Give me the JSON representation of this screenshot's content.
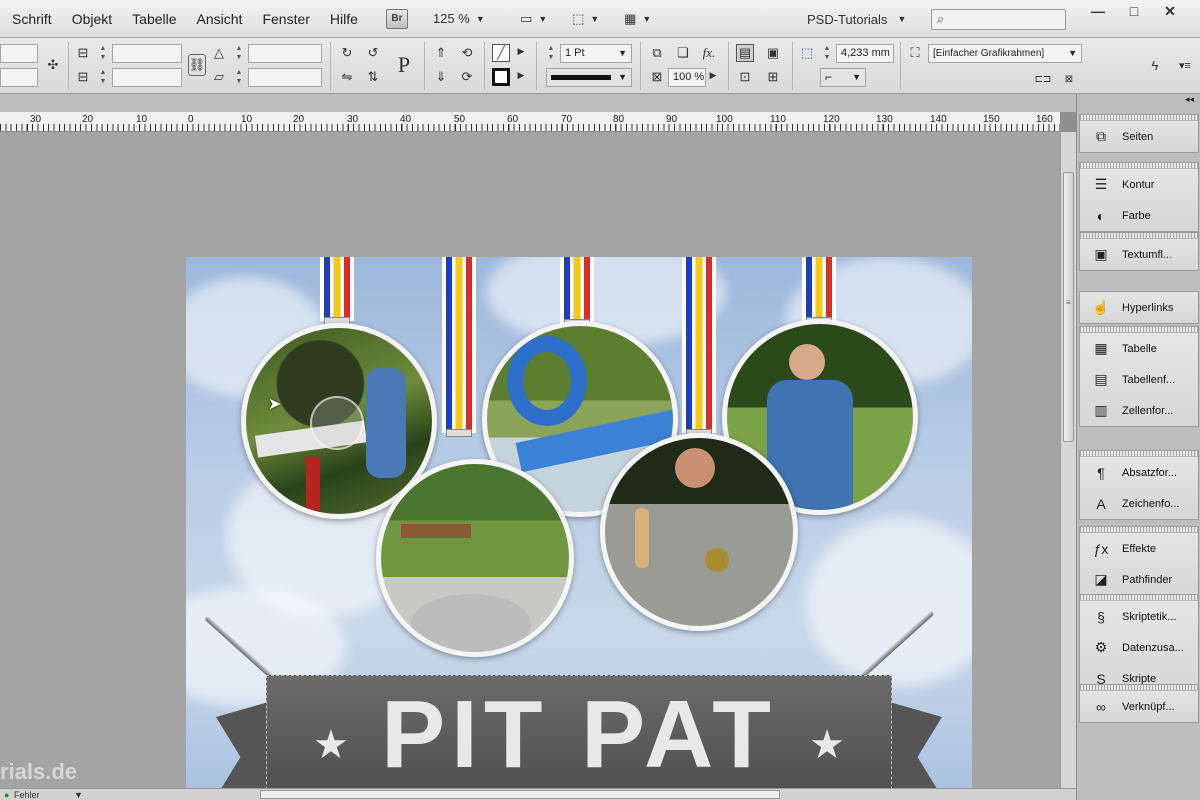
{
  "menu": {
    "items": [
      "Schrift",
      "Objekt",
      "Tabelle",
      "Ansicht",
      "Fenster",
      "Hilfe"
    ],
    "bridge_badge": "Br",
    "zoom": "125 %",
    "workspace": "PSD-Tutorials",
    "window_minimize": "—",
    "window_maximize": "□",
    "window_close": "✕"
  },
  "control": {
    "stroke_weight": "1 Pt",
    "object_style": "[Einfacher Grafikrahmen]",
    "stroke_width_value": "4,233 mm",
    "opacity": "100 %",
    "fx_label": "fx."
  },
  "ruler": {
    "labels": [
      "30",
      "20",
      "10",
      "0",
      "10",
      "20",
      "30",
      "40",
      "50",
      "60",
      "70",
      "80",
      "90",
      "100",
      "110",
      "120",
      "130",
      "140",
      "150",
      "160"
    ]
  },
  "document": {
    "banner_text": "PIT PAT",
    "star": "★",
    "watermark": "rials.de"
  },
  "status": {
    "errors": "Fehler"
  },
  "panels": {
    "groups": [
      [
        {
          "label": "Seiten",
          "icon": "pages-icon",
          "glyph": "⧉"
        }
      ],
      [
        {
          "label": "Kontur",
          "icon": "stroke-icon",
          "glyph": "☰"
        },
        {
          "label": "Farbe",
          "icon": "color-palette-icon",
          "glyph": "◐"
        }
      ],
      [
        {
          "label": "Textumfl...",
          "icon": "text-wrap-icon",
          "glyph": "▣"
        }
      ],
      [
        {
          "label": "Hyperlinks",
          "icon": "hyperlinks-icon",
          "glyph": "☝"
        }
      ],
      [
        {
          "label": "Tabelle",
          "icon": "table-icon",
          "glyph": "▦"
        },
        {
          "label": "Tabellenf...",
          "icon": "table-styles-icon",
          "glyph": "▤"
        },
        {
          "label": "Zellenfor...",
          "icon": "cell-styles-icon",
          "glyph": "▥"
        }
      ],
      [
        {
          "label": "Absatzfor...",
          "icon": "paragraph-styles-icon",
          "glyph": "¶"
        },
        {
          "label": "Zeichenfo...",
          "icon": "character-styles-icon",
          "glyph": "A"
        }
      ],
      [
        {
          "label": "Effekte",
          "icon": "effects-icon",
          "glyph": "ƒx"
        },
        {
          "label": "Pathfinder",
          "icon": "pathfinder-icon",
          "glyph": "◪"
        }
      ],
      [
        {
          "label": "Skriptetik...",
          "icon": "script-label-icon",
          "glyph": "§"
        },
        {
          "label": "Datenzusa...",
          "icon": "data-merge-icon",
          "glyph": "⚙"
        },
        {
          "label": "Skripte",
          "icon": "scripts-icon",
          "glyph": "S"
        }
      ],
      [
        {
          "label": "Verknüpf...",
          "icon": "links-icon",
          "glyph": "∞"
        }
      ]
    ]
  }
}
